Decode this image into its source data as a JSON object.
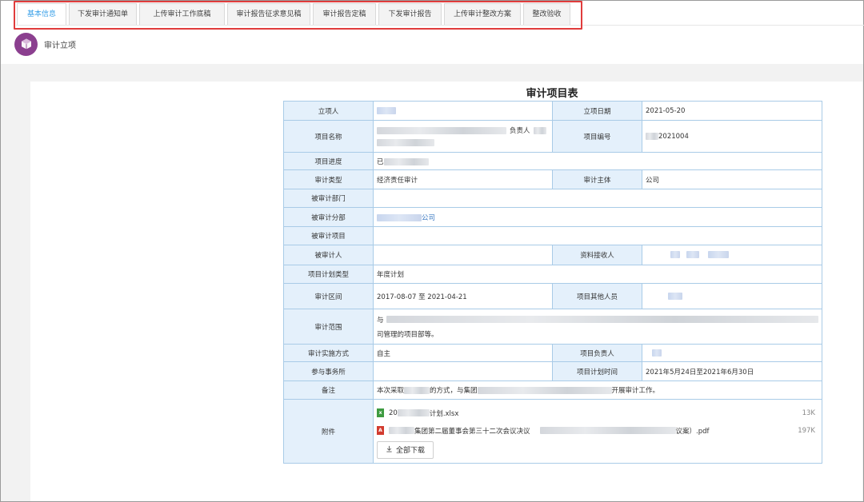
{
  "tabs": [
    {
      "label": "基本信息",
      "active": true
    },
    {
      "label": "下发审计通知单"
    },
    {
      "label": "上传审计工作底稿"
    },
    {
      "label": "审计报告征求意见稿"
    },
    {
      "label": "审计报告定稿"
    },
    {
      "label": "下发审计报告"
    },
    {
      "label": "上传审计整改方案"
    },
    {
      "label": "整改验收"
    }
  ],
  "header": {
    "title": "审计立项",
    "icon": "cube-icon"
  },
  "doc_title": "审计项目表",
  "labels": {
    "creator": "立项人",
    "date": "立项日期",
    "project_name": "项目名称",
    "project_no": "项目编号",
    "progress": "项目进度",
    "audit_type": "审计类型",
    "audit_subject": "审计主体",
    "audited_dept": "被审计部门",
    "audited_branch": "被审计分部",
    "audited_project": "被审计项目",
    "audited_person": "被审计人",
    "receiver": "资料接收人",
    "plan_type": "项目计划类型",
    "interval": "审计区间",
    "other_members": "项目其他人员",
    "scope": "审计范围",
    "method": "审计实施方式",
    "leader": "项目负责人",
    "firm": "参与事务所",
    "plan_time": "项目计划时间",
    "remark": "备注",
    "attachment": "附件"
  },
  "values": {
    "date": "2021-05-20",
    "leader_prefix": "负责人",
    "project_no_suffix": "2021004",
    "progress_prefix": "已",
    "audit_type": "经济责任审计",
    "audit_subject": "公司",
    "branch_suffix": "公司",
    "plan_type": "年度计划",
    "interval": "2017-08-07 至  2021-04-21",
    "scope_prefix": "与",
    "scope_line2": "司管理的项目部等。",
    "method": "自主",
    "plan_time": "2021年5月24日至2021年6月30日",
    "remark_a": "本次采取",
    "remark_b": "的方式，与集团",
    "remark_c": "开展审计工作。"
  },
  "attachments": [
    {
      "prefix": "20",
      "suffix": "计划.xlsx",
      "size": "13K",
      "icon": "xlsx-file-icon"
    },
    {
      "prefix": "",
      "middle": "集团第二届董事会第三十二次会议决议",
      "suffix": "议案）.pdf",
      "size": "197K",
      "icon": "pdf-file-icon"
    }
  ],
  "download_all": "全部下载",
  "colors": {
    "accent": "#3aa0e8",
    "highlight_box": "#e03c3c",
    "label_bg": "#e4f0fb",
    "border": "#a9cbe7",
    "logo": "#8b3f8f"
  }
}
